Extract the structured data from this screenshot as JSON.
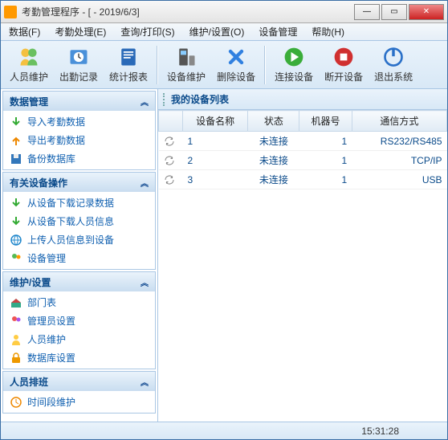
{
  "window": {
    "title": "考勤管理程序 - [ - 2019/6/3]"
  },
  "menu": {
    "items": [
      "数据(F)",
      "考勤处理(E)",
      "查询/打印(S)",
      "维护/设置(O)",
      "设备管理",
      "帮助(H)"
    ]
  },
  "toolbar": {
    "items": [
      {
        "label": "人员维护",
        "icon": "people"
      },
      {
        "label": "出勤记录",
        "icon": "clock"
      },
      {
        "label": "统计报表",
        "icon": "report"
      },
      {
        "label": "设备维护",
        "icon": "device"
      },
      {
        "label": "删除设备",
        "icon": "delete"
      },
      {
        "label": "连接设备",
        "icon": "play"
      },
      {
        "label": "断开设备",
        "icon": "stop"
      },
      {
        "label": "退出系统",
        "icon": "power"
      }
    ]
  },
  "sidebar": {
    "groups": [
      {
        "title": "数据管理",
        "items": [
          {
            "label": "导入考勤数据",
            "icon": "down-green"
          },
          {
            "label": "导出考勤数据",
            "icon": "up-orange"
          },
          {
            "label": "备份数据库",
            "icon": "disk"
          }
        ]
      },
      {
        "title": "有关设备操作",
        "items": [
          {
            "label": "从设备下载记录数据",
            "icon": "down-green"
          },
          {
            "label": "从设备下载人员信息",
            "icon": "down-green"
          },
          {
            "label": "上传人员信息到设备",
            "icon": "globe"
          },
          {
            "label": "设备管理",
            "icon": "people-sm"
          }
        ]
      },
      {
        "title": "维护/设置",
        "items": [
          {
            "label": "部门表",
            "icon": "house"
          },
          {
            "label": "管理员设置",
            "icon": "mgr"
          },
          {
            "label": "人员维护",
            "icon": "person"
          },
          {
            "label": "数据库设置",
            "icon": "lock"
          }
        ]
      },
      {
        "title": "人员排班",
        "items": [
          {
            "label": "时间段维护",
            "icon": "time"
          }
        ]
      }
    ]
  },
  "right": {
    "tab_label": "我的设备列表",
    "columns": [
      "设备名称",
      "状态",
      "机器号",
      "通信方式"
    ],
    "rows": [
      {
        "name": "1",
        "status": "未连接",
        "mid": "1",
        "comm": "RS232/RS485"
      },
      {
        "name": "2",
        "status": "未连接",
        "mid": "1",
        "comm": "TCP/IP"
      },
      {
        "name": "3",
        "status": "未连接",
        "mid": "1",
        "comm": "USB"
      }
    ]
  },
  "status": {
    "time": "15:31:28"
  }
}
